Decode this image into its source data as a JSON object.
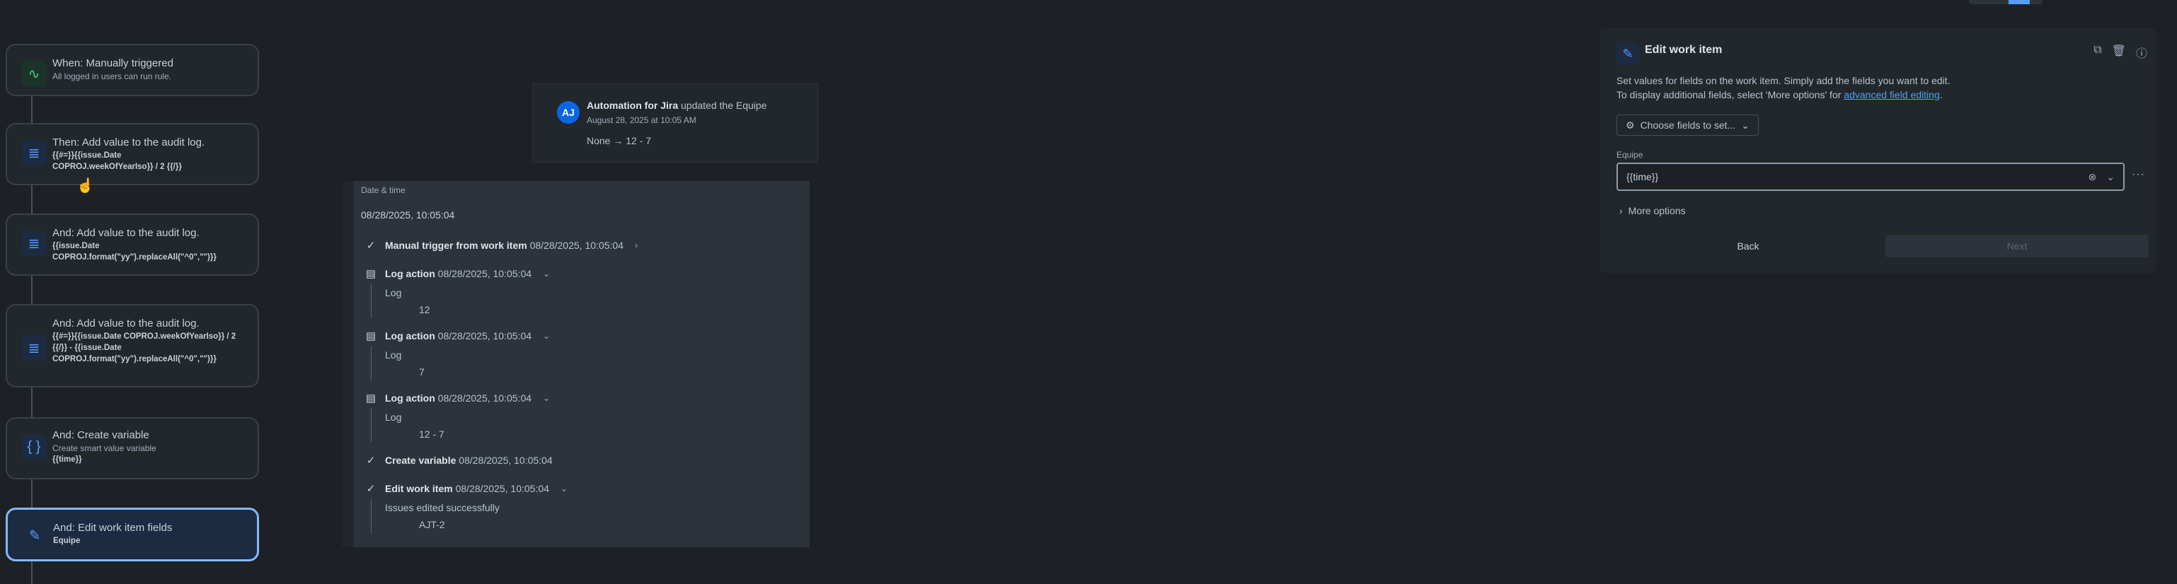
{
  "rule_flow": {
    "cards": [
      {
        "title": "When: Manually triggered",
        "subtitle": "All logged in users can run rule.",
        "bold": "",
        "icon": "pulse-icon"
      },
      {
        "title": "Then: Add value to the audit log.",
        "subtitle": "",
        "bold": "{{#=}}{{issue.Date COPROJ.weekOfYearIso}} / 2 {{/}}",
        "icon": "list-icon"
      },
      {
        "title": "And: Add value to the audit log.",
        "subtitle": "",
        "bold": "{{issue.Date COPROJ.format(\"yy\").replaceAll(\"^0\",\"\")}}",
        "icon": "list-icon"
      },
      {
        "title": "And: Add value to the audit log.",
        "subtitle": "",
        "bold": "{{#=}}{{issue.Date COPROJ.weekOfYearIso}} / 2 {{/}} - {{issue.Date COPROJ.format(\"yy\").replaceAll(\"^0\",\"\")}}",
        "icon": "list-icon"
      },
      {
        "title": "And: Create variable",
        "subtitle": "Create smart value variable",
        "bold": "{{time}}",
        "icon": "braces-icon"
      },
      {
        "title": "And: Edit work item fields",
        "subtitle": "",
        "bold": "Equipe",
        "icon": "edit-icon"
      }
    ]
  },
  "notification": {
    "avatar": "AJ",
    "actor": "Automation for Jira",
    "action": "updated the Equipe",
    "timestamp": "August 28, 2025 at 10:05 AM",
    "from": "None",
    "arrow": "→",
    "to": "12 - 7"
  },
  "audit_log": {
    "header": "Date & time",
    "date": "08/28/2025, 10:05:04",
    "entries": [
      {
        "icon": "check-icon",
        "label": "Manual trigger from work item",
        "time": "08/28/2025, 10:05:04",
        "chevron": "›"
      },
      {
        "icon": "log-icon",
        "label": "Log action",
        "time": "08/28/2025, 10:05:04",
        "chevron": "⌄",
        "sub_label": "Log",
        "value": "12"
      },
      {
        "icon": "log-icon",
        "label": "Log action",
        "time": "08/28/2025, 10:05:04",
        "chevron": "⌄",
        "sub_label": "Log",
        "value": "7"
      },
      {
        "icon": "log-icon",
        "label": "Log action",
        "time": "08/28/2025, 10:05:04",
        "chevron": "⌄",
        "sub_label": "Log",
        "value": "12 - 7"
      },
      {
        "icon": "check-icon",
        "label": "Create variable",
        "time": "08/28/2025, 10:05:04"
      },
      {
        "icon": "check-icon",
        "label": "Edit work item",
        "time": "08/28/2025, 10:05:04",
        "chevron": "⌄",
        "sub_label": "Issues edited successfully",
        "value": "AJT-2"
      }
    ]
  },
  "edit_panel": {
    "title": "Edit work item",
    "desc_line1": "Set values for fields on the work item. Simply add the fields you want to edit.",
    "desc_line2_prefix": "To display additional fields, select 'More options' for ",
    "desc_link": "advanced field editing",
    "desc_line2_suffix": ".",
    "choose_label": "Choose fields to set...",
    "field_label": "Equipe",
    "field_value": "{{time}}",
    "more_options": "More options",
    "back": "Back",
    "next": "Next"
  },
  "colors": {
    "accent": "#579dff",
    "background": "#1d2125",
    "card": "#22272b",
    "selected_border": "#85b8ff"
  }
}
